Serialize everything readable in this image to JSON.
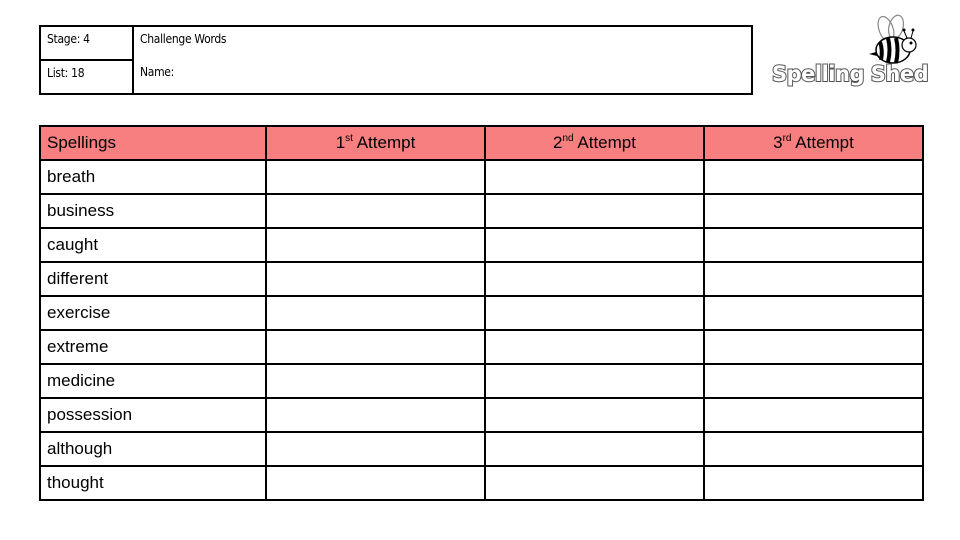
{
  "info": {
    "stage": "Stage: 4",
    "list": "List: 18",
    "title": "Challenge Words",
    "name_label": "Name:"
  },
  "logo": {
    "text": "Spelling Shed",
    "icon": "bee-icon"
  },
  "table": {
    "header_color": "#f87f7f",
    "headers": [
      {
        "label": "Spellings"
      },
      {
        "num": "1",
        "sup": "st",
        "label": " Attempt"
      },
      {
        "num": "2",
        "sup": "nd",
        "label": " Attempt"
      },
      {
        "num": "3",
        "sup": "rd",
        "label": " Attempt"
      }
    ],
    "words": [
      "breath",
      "business",
      "caught",
      "different",
      "exercise",
      "extreme",
      "medicine",
      "possession",
      "although",
      "thought"
    ]
  }
}
